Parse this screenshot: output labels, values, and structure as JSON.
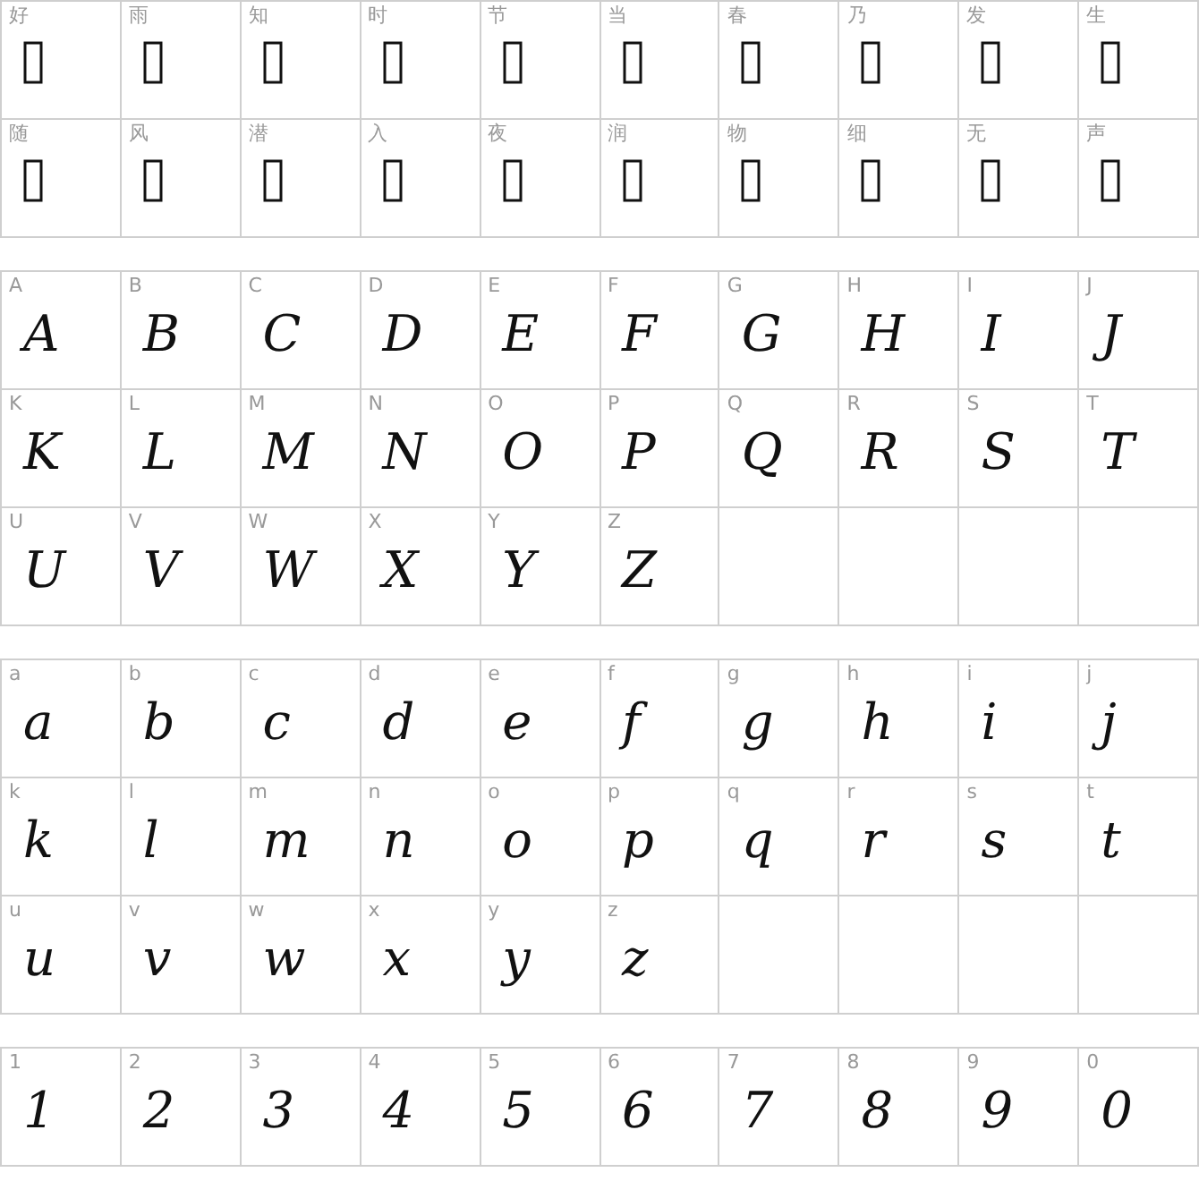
{
  "sections": [
    {
      "cells": [
        {
          "label": "好",
          "kind": "missing"
        },
        {
          "label": "雨",
          "kind": "missing"
        },
        {
          "label": "知",
          "kind": "missing"
        },
        {
          "label": "时",
          "kind": "missing"
        },
        {
          "label": "节",
          "kind": "missing"
        },
        {
          "label": "当",
          "kind": "missing"
        },
        {
          "label": "春",
          "kind": "missing"
        },
        {
          "label": "乃",
          "kind": "missing"
        },
        {
          "label": "发",
          "kind": "missing"
        },
        {
          "label": "生",
          "kind": "missing"
        },
        {
          "label": "随",
          "kind": "missing"
        },
        {
          "label": "风",
          "kind": "missing"
        },
        {
          "label": "潜",
          "kind": "missing"
        },
        {
          "label": "入",
          "kind": "missing"
        },
        {
          "label": "夜",
          "kind": "missing"
        },
        {
          "label": "润",
          "kind": "missing"
        },
        {
          "label": "物",
          "kind": "missing"
        },
        {
          "label": "细",
          "kind": "missing"
        },
        {
          "label": "无",
          "kind": "missing"
        },
        {
          "label": "声",
          "kind": "missing"
        }
      ]
    },
    {
      "cells": [
        {
          "label": "A",
          "kind": "glyph",
          "glyph": "A"
        },
        {
          "label": "B",
          "kind": "glyph",
          "glyph": "B"
        },
        {
          "label": "C",
          "kind": "glyph",
          "glyph": "C"
        },
        {
          "label": "D",
          "kind": "glyph",
          "glyph": "D"
        },
        {
          "label": "E",
          "kind": "glyph",
          "glyph": "E"
        },
        {
          "label": "F",
          "kind": "glyph",
          "glyph": "F"
        },
        {
          "label": "G",
          "kind": "glyph",
          "glyph": "G"
        },
        {
          "label": "H",
          "kind": "glyph",
          "glyph": "H"
        },
        {
          "label": "I",
          "kind": "glyph",
          "glyph": "I"
        },
        {
          "label": "J",
          "kind": "glyph",
          "glyph": "J"
        },
        {
          "label": "K",
          "kind": "glyph",
          "glyph": "K"
        },
        {
          "label": "L",
          "kind": "glyph",
          "glyph": "L"
        },
        {
          "label": "M",
          "kind": "glyph",
          "glyph": "M"
        },
        {
          "label": "N",
          "kind": "glyph",
          "glyph": "N"
        },
        {
          "label": "O",
          "kind": "glyph",
          "glyph": "O"
        },
        {
          "label": "P",
          "kind": "glyph",
          "glyph": "P"
        },
        {
          "label": "Q",
          "kind": "glyph",
          "glyph": "Q"
        },
        {
          "label": "R",
          "kind": "glyph",
          "glyph": "R"
        },
        {
          "label": "S",
          "kind": "glyph",
          "glyph": "S"
        },
        {
          "label": "T",
          "kind": "glyph",
          "glyph": "T"
        },
        {
          "label": "U",
          "kind": "glyph",
          "glyph": "U"
        },
        {
          "label": "V",
          "kind": "glyph",
          "glyph": "V"
        },
        {
          "label": "W",
          "kind": "glyph",
          "glyph": "W"
        },
        {
          "label": "X",
          "kind": "glyph",
          "glyph": "X"
        },
        {
          "label": "Y",
          "kind": "glyph",
          "glyph": "Y"
        },
        {
          "label": "Z",
          "kind": "glyph",
          "glyph": "Z"
        }
      ]
    },
    {
      "cells": [
        {
          "label": "a",
          "kind": "glyph",
          "glyph": "a"
        },
        {
          "label": "b",
          "kind": "glyph",
          "glyph": "b"
        },
        {
          "label": "c",
          "kind": "glyph",
          "glyph": "c"
        },
        {
          "label": "d",
          "kind": "glyph",
          "glyph": "d"
        },
        {
          "label": "e",
          "kind": "glyph",
          "glyph": "e"
        },
        {
          "label": "f",
          "kind": "glyph",
          "glyph": "f"
        },
        {
          "label": "g",
          "kind": "glyph",
          "glyph": "g"
        },
        {
          "label": "h",
          "kind": "glyph",
          "glyph": "h"
        },
        {
          "label": "i",
          "kind": "glyph",
          "glyph": "i"
        },
        {
          "label": "j",
          "kind": "glyph",
          "glyph": "j"
        },
        {
          "label": "k",
          "kind": "glyph",
          "glyph": "k"
        },
        {
          "label": "l",
          "kind": "glyph",
          "glyph": "l"
        },
        {
          "label": "m",
          "kind": "glyph",
          "glyph": "m"
        },
        {
          "label": "n",
          "kind": "glyph",
          "glyph": "n"
        },
        {
          "label": "o",
          "kind": "glyph",
          "glyph": "o"
        },
        {
          "label": "p",
          "kind": "glyph",
          "glyph": "p"
        },
        {
          "label": "q",
          "kind": "glyph",
          "glyph": "q"
        },
        {
          "label": "r",
          "kind": "glyph",
          "glyph": "r"
        },
        {
          "label": "s",
          "kind": "glyph",
          "glyph": "s"
        },
        {
          "label": "t",
          "kind": "glyph",
          "glyph": "t"
        },
        {
          "label": "u",
          "kind": "glyph",
          "glyph": "u"
        },
        {
          "label": "v",
          "kind": "glyph",
          "glyph": "v"
        },
        {
          "label": "w",
          "kind": "glyph",
          "glyph": "w"
        },
        {
          "label": "x",
          "kind": "glyph",
          "glyph": "x"
        },
        {
          "label": "y",
          "kind": "glyph",
          "glyph": "y"
        },
        {
          "label": "z",
          "kind": "glyph",
          "glyph": "z"
        }
      ]
    },
    {
      "cells": [
        {
          "label": "1",
          "kind": "glyph",
          "glyph": "1"
        },
        {
          "label": "2",
          "kind": "glyph",
          "glyph": "2"
        },
        {
          "label": "3",
          "kind": "glyph",
          "glyph": "3"
        },
        {
          "label": "4",
          "kind": "glyph",
          "glyph": "4"
        },
        {
          "label": "5",
          "kind": "glyph",
          "glyph": "5"
        },
        {
          "label": "6",
          "kind": "glyph",
          "glyph": "6"
        },
        {
          "label": "7",
          "kind": "glyph",
          "glyph": "7"
        },
        {
          "label": "8",
          "kind": "glyph",
          "glyph": "8"
        },
        {
          "label": "9",
          "kind": "glyph",
          "glyph": "9"
        },
        {
          "label": "0",
          "kind": "glyph",
          "glyph": "0"
        }
      ]
    }
  ]
}
